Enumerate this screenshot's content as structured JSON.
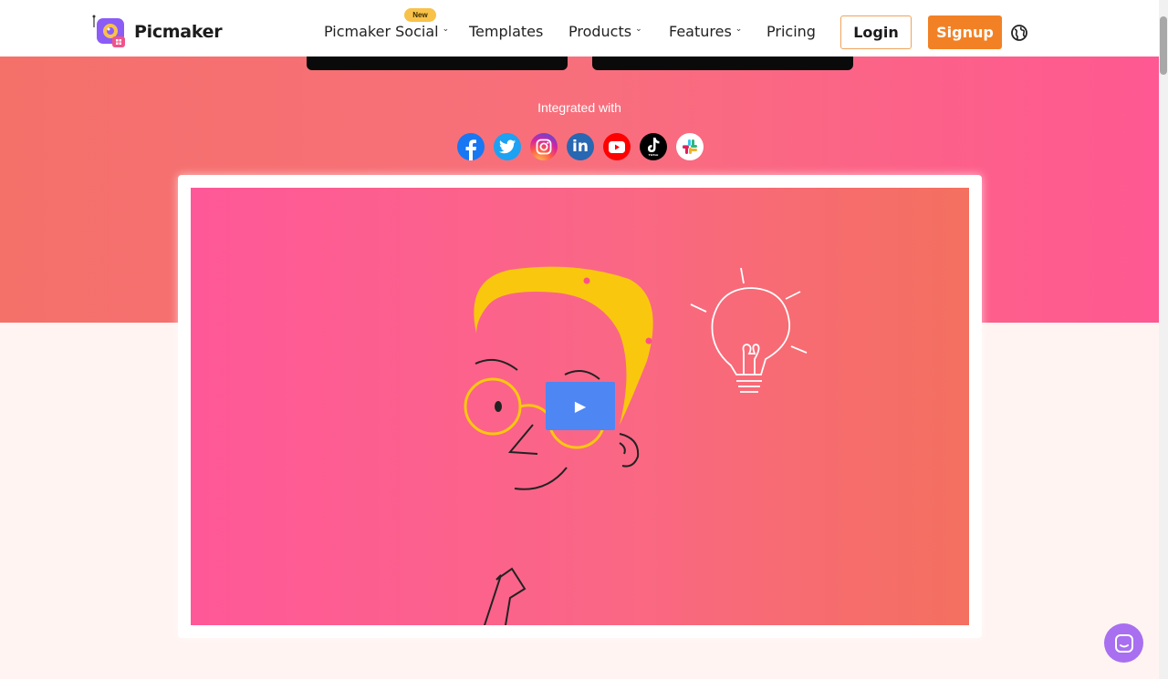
{
  "brand": {
    "name": "Picmaker"
  },
  "nav": {
    "items": [
      {
        "label": "Picmaker Social",
        "has_dropdown": true
      },
      {
        "label": "Templates",
        "has_dropdown": false
      },
      {
        "label": "Products",
        "has_dropdown": true
      },
      {
        "label": "Features",
        "has_dropdown": true
      },
      {
        "label": "Pricing",
        "has_dropdown": false
      }
    ],
    "new_badge": "New",
    "chevron": "⌄",
    "login_label": "Login",
    "signup_label": "Signup"
  },
  "hero": {
    "integrated_label": "Integrated with",
    "integrations": [
      "facebook-icon",
      "twitter-icon",
      "instagram-icon",
      "linkedin-icon",
      "youtube-icon",
      "tiktok-icon",
      "slack-icon"
    ]
  },
  "video": {
    "play_icon": "▶"
  },
  "colors": {
    "accent": "#f28125",
    "hero_gradient_start": "#f4716a",
    "hero_gradient_end": "#ff5892",
    "play_button": "#4e86f4",
    "chat": "#a86ff0"
  }
}
